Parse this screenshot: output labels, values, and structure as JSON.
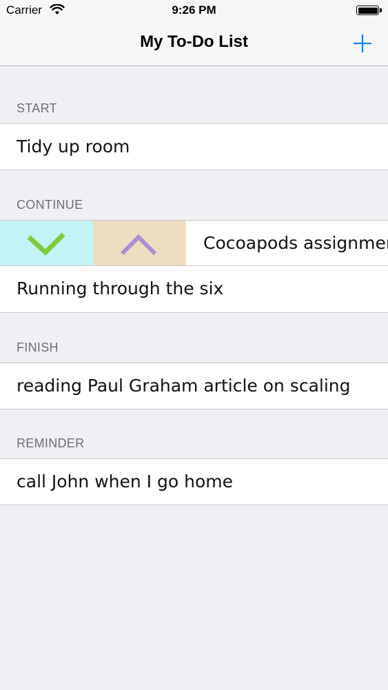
{
  "status_bar": {
    "carrier": "Carrier",
    "time": "9:26 PM"
  },
  "nav": {
    "title": "My To-Do List",
    "add_icon": "plus-icon"
  },
  "sections": [
    {
      "header": "START",
      "rows": [
        "Tidy up room"
      ]
    },
    {
      "header": "CONTINUE",
      "rows": [
        "Cocoapods assignment",
        "Running through the six"
      ]
    },
    {
      "header": "FINISH",
      "rows": [
        "reading Paul Graham article on scaling"
      ]
    },
    {
      "header": "REMINDER",
      "rows": [
        "call John when I go home"
      ]
    }
  ],
  "swipe_actions": {
    "done": {
      "icon": "checkmark-icon",
      "background": "#c4f3f5",
      "icon_color": "#7ccc3a"
    },
    "move_up": {
      "icon": "chevron-up-icon",
      "background": "#eeddc0",
      "icon_color": "#a88fd6"
    }
  },
  "colors": {
    "accent": "#1a7cf5",
    "background": "#efeff4"
  }
}
